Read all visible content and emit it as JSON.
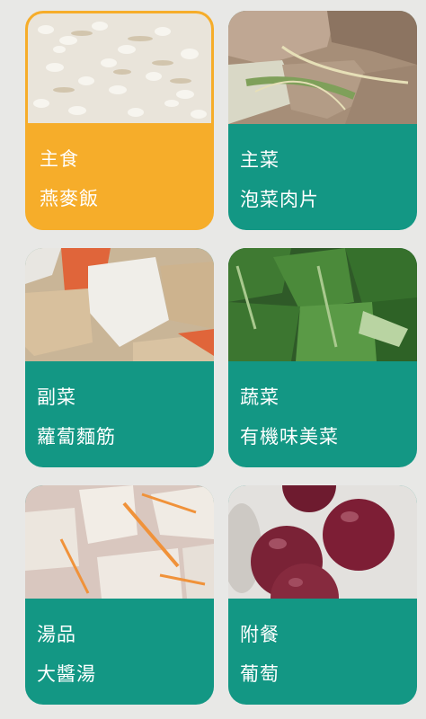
{
  "colors": {
    "selected_bg": "#f6ad2a",
    "card_bg": "#139784",
    "page_bg": "#e8e8e6"
  },
  "cards": [
    {
      "category": "主食",
      "dish": "燕麥飯",
      "selected": true,
      "image": "rice-photo"
    },
    {
      "category": "主菜",
      "dish": "泡菜肉片",
      "selected": false,
      "image": "pork-kimchi-photo"
    },
    {
      "category": "副菜",
      "dish": "蘿蔔麵筋",
      "selected": false,
      "image": "radish-gluten-photo"
    },
    {
      "category": "蔬菜",
      "dish": "有機味美菜",
      "selected": false,
      "image": "greens-photo"
    },
    {
      "category": "湯品",
      "dish": "大醬湯",
      "selected": false,
      "image": "tofu-soup-photo"
    },
    {
      "category": "附餐",
      "dish": "葡萄",
      "selected": false,
      "image": "grapes-photo"
    }
  ]
}
